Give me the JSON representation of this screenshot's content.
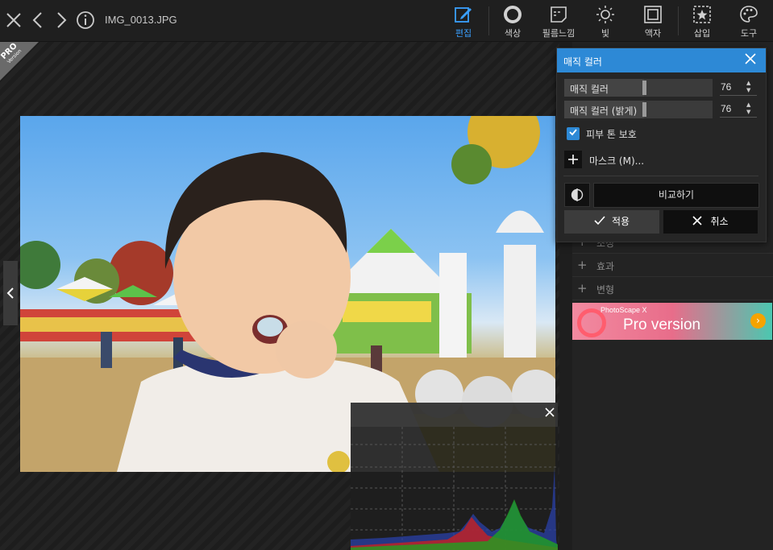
{
  "header": {
    "filename": "IMG_0013.JPG",
    "tools": [
      {
        "label": "편집",
        "icon": "edit-icon",
        "active": true
      },
      {
        "label": "색상",
        "icon": "color-circle-icon"
      },
      {
        "label": "필름느낌",
        "icon": "film-icon"
      },
      {
        "label": "빛",
        "icon": "sun-icon"
      },
      {
        "label": "액자",
        "icon": "frame-icon"
      },
      {
        "label": "삽입",
        "icon": "insert-star-icon"
      },
      {
        "label": "도구",
        "icon": "palette-icon"
      }
    ],
    "accent_color": "#3aa0ff"
  },
  "canvas": {
    "pro_badge": {
      "line1": "PRO",
      "line2": "Version"
    }
  },
  "right_panel": {
    "sections": [
      {
        "label": "조정"
      },
      {
        "label": "효과"
      },
      {
        "label": "변형"
      }
    ],
    "banner": {
      "small_text": "PhotoScape X",
      "big_text": "Pro version"
    }
  },
  "dialog": {
    "title": "매직 컬러",
    "sliders": [
      {
        "label": "매직 컬러",
        "value": "76",
        "level": 0.54
      },
      {
        "label": "매직 컬러 (밝게)",
        "value": "76",
        "level": 0.54
      }
    ],
    "checkbox_label": "피부 톤 보호",
    "checkbox_checked": true,
    "mask_label": "마스크 (M)...",
    "compare_label": "비교하기",
    "apply_label": "적용",
    "cancel_label": "취소",
    "title_color": "#2d89d6"
  }
}
